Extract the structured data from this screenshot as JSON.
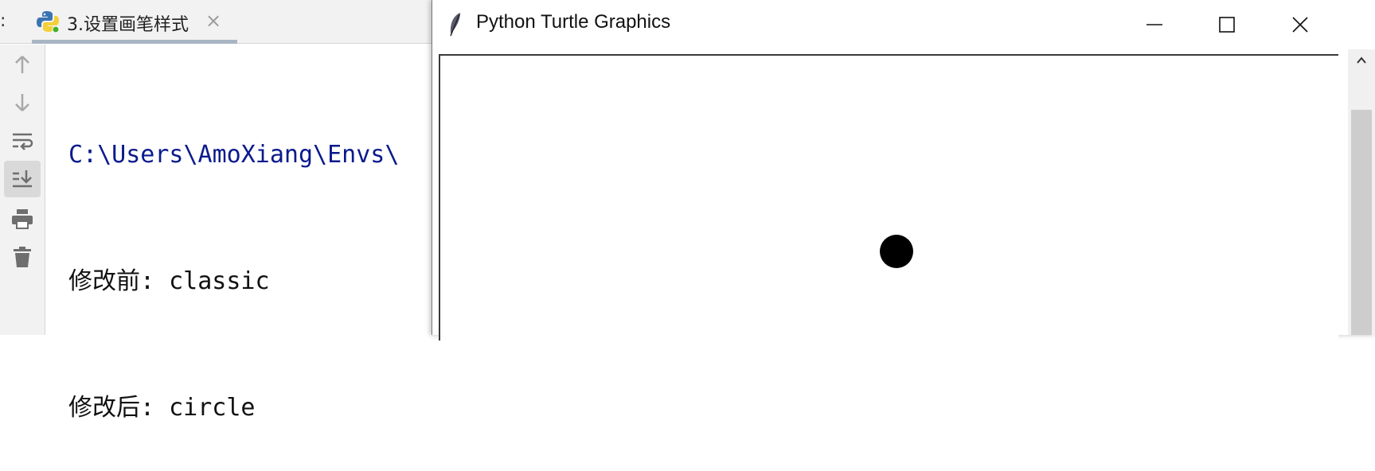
{
  "ide": {
    "tab_prefix": ":",
    "tab": {
      "label": "3.设置画笔样式",
      "close": "×"
    },
    "console": {
      "lines": {
        "path": "C:\\Users\\AmoXiang\\Envs\\",
        "before": "修改前: classic",
        "after": "修改后: circle"
      }
    },
    "gutter_icons": [
      "arrow-up-icon",
      "arrow-down-icon",
      "soft-wrap-icon",
      "scroll-to-end-icon",
      "print-icon",
      "trash-icon"
    ]
  },
  "turtle_window": {
    "title": "Python Turtle Graphics",
    "controls": [
      "minimize",
      "maximize",
      "close"
    ],
    "turtle_shape": "circle",
    "colors": {
      "turtle": "#000000",
      "canvas": "#ffffff"
    }
  }
}
